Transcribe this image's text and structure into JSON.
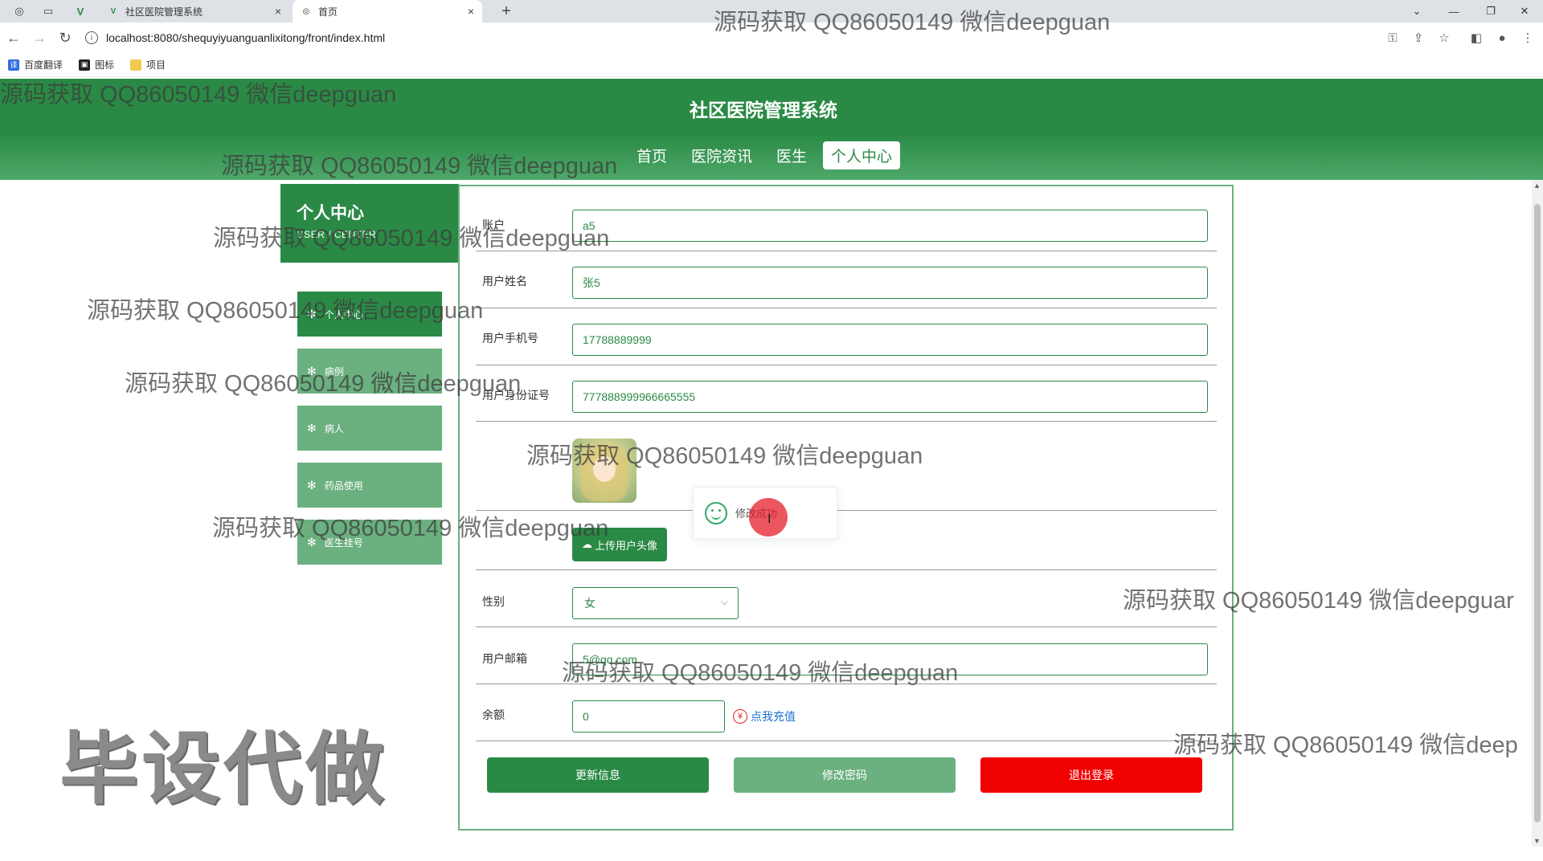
{
  "browser": {
    "tabs": [
      {
        "title": "社区医院管理系统",
        "close": "×"
      },
      {
        "title": "首页",
        "close": "×"
      }
    ],
    "new_tab": "+",
    "url": "localhost:8080/shequyiyuanguanlixitong/front/index.html",
    "bookmarks": [
      {
        "label": "百度翻译",
        "color": "#2f6ee0"
      },
      {
        "label": "图标",
        "color": "#222222"
      },
      {
        "label": "项目",
        "color": "#f2c94c"
      }
    ]
  },
  "site": {
    "title": "社区医院管理系统",
    "nav": [
      "首页",
      "医院资讯",
      "医生",
      "个人中心"
    ],
    "active_nav": "个人中心",
    "brand_color": "#2a8a45"
  },
  "sidebar": {
    "title": "个人中心",
    "subtitle": "USER / CENTER",
    "items": [
      {
        "label": "个人中心",
        "active": true
      },
      {
        "label": "病例",
        "active": false
      },
      {
        "label": "病人",
        "active": false
      },
      {
        "label": "药品使用",
        "active": false
      },
      {
        "label": "医生挂号",
        "active": false
      }
    ]
  },
  "form": {
    "account": {
      "label": "账户",
      "value": "a5"
    },
    "name": {
      "label": "用户姓名",
      "value": "张5"
    },
    "phone": {
      "label": "用户手机号",
      "value": "17788889999"
    },
    "id_card": {
      "label": "用户身份证号",
      "value": "777888999966665555"
    },
    "upload_label": "上传用户头像",
    "gender": {
      "label": "性别",
      "value": "女"
    },
    "email": {
      "label": "用户邮箱",
      "value": "5@qq.com"
    },
    "balance": {
      "label": "余额",
      "value": "0"
    },
    "recharge_label": "点我充值",
    "recharge_icon": "¥"
  },
  "actions": {
    "update": "更新信息",
    "change_password": "修改密码",
    "logout": "退出登录"
  },
  "toast": {
    "message": "修改成功"
  },
  "watermarks": {
    "text": "源码获取 QQ86050149 微信deepguan",
    "cut_right_1": "源码获取 QQ86050149 微信deepguar",
    "cut_right_2": "源码获取 QQ86050149 微信deep",
    "big": "毕设代做"
  }
}
